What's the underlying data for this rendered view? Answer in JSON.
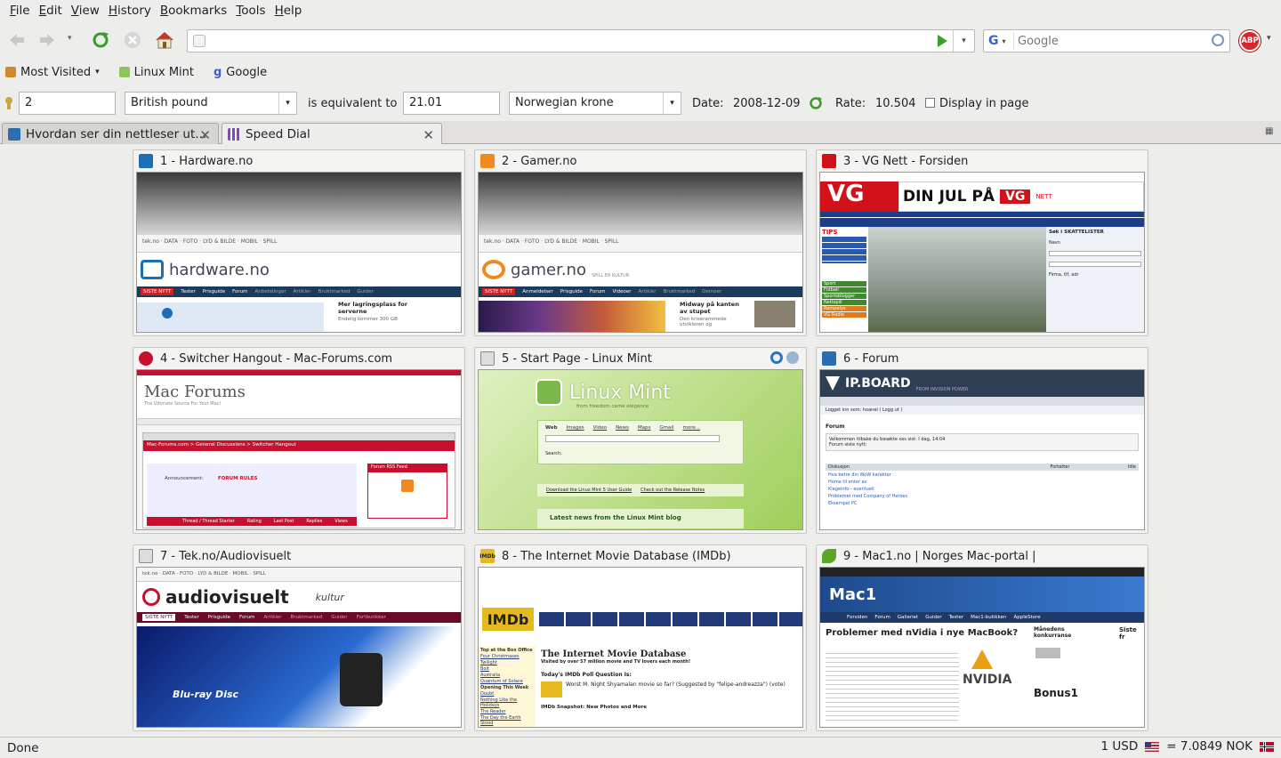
{
  "menubar": {
    "items": [
      {
        "label": "File",
        "key": "F",
        "rest": "ile"
      },
      {
        "label": "Edit",
        "key": "E",
        "rest": "dit"
      },
      {
        "label": "View",
        "key": "V",
        "rest": "iew"
      },
      {
        "label": "History",
        "key": "H",
        "rest": "istory"
      },
      {
        "label": "Bookmarks",
        "key": "B",
        "rest": "ookmarks"
      },
      {
        "label": "Tools",
        "key": "T",
        "rest": "ools"
      },
      {
        "label": "Help",
        "key": "H",
        "rest": "elp"
      }
    ]
  },
  "navbar": {
    "url_value": "",
    "search_placeholder": "Google",
    "search_engine": "G",
    "adblock_label": "ABP"
  },
  "bookmarks": {
    "items": [
      "Most Visited",
      "Linux Mint",
      "Google"
    ]
  },
  "currency": {
    "amount": "2",
    "from_currency": "British pound",
    "equivalent_label": "is equivalent to",
    "result": "21.01",
    "to_currency": "Norwegian krone",
    "date_label": "Date:",
    "date_value": "2008-12-09",
    "rate_label": "Rate:",
    "rate_value": "10.504",
    "display_label": "Display in page"
  },
  "tabs": [
    {
      "label": "Hvordan ser din nettleser ut...",
      "active": false
    },
    {
      "label": "Speed Dial",
      "active": true
    }
  ],
  "speed_dial": [
    {
      "title": "1 - Hardware.no",
      "color": "#1b6fb8"
    },
    {
      "title": "2 - Gamer.no",
      "color": "#f08a1c"
    },
    {
      "title": "3 - VG Nett - Forsiden",
      "color": "#d2121a"
    },
    {
      "title": "4 - Switcher Hangout - Mac-Forums.com",
      "color": "#c8102e"
    },
    {
      "title": "5 - Start Page - Linux Mint",
      "color": "#7a7a7a"
    },
    {
      "title": "6 - Forum",
      "color": "#2a6db0"
    },
    {
      "title": "7 - Tek.no/Audiovisuelt",
      "color": "#7a7a7a"
    },
    {
      "title": "8 - The Internet Movie Database (IMDb)",
      "color": "#e6b91e"
    },
    {
      "title": "9 - Mac1.no | Norges Mac-portal |",
      "color": "#5aa628"
    }
  ],
  "thumbs": {
    "t1": {
      "site": "hardware.no",
      "nav": [
        "SISTE NYTT",
        "Tester",
        "Prisguide",
        "Forum",
        "Anbefalinger",
        "Artikler",
        "Bruktmarked",
        "Guider"
      ],
      "headline": "Mer lagringsplass for serverne",
      "sub": "Endelig kommer 300 GB"
    },
    "t2": {
      "site": "gamer.no",
      "tag": "SPILL ER KULTUR",
      "nav": [
        "SISTE NYTT",
        "Anmeldelser",
        "Prisguide",
        "Forum",
        "Videoer",
        "Artikler",
        "Bruktmarked",
        "Demoer"
      ],
      "headline": "Midway på kanten av stupet",
      "sub": "Den kriserammede utvikleren og"
    },
    "t3": {
      "logo": "VG",
      "banner": "DIN JUL PÅ",
      "sub": "NETT",
      "tips": "TIPS",
      "menu": [
        "Sport",
        "Fotball",
        "Sportsblogger",
        "Nettspill",
        "Rampelys",
        "VG Radio"
      ],
      "side": "Søk i SKATTELISTER",
      "name": "Navn",
      "firma": "Firma, tlf, adr"
    },
    "t4": {
      "logo": "Mac Forums",
      "tagline": "The Ultimate Source For Your Mac!",
      "crumb": "Mac-Forums.com > General Discussions > Switcher Hangout",
      "announce": "Announcement:",
      "rules": "FORUM RULES",
      "feed": "Forum RSS Feed",
      "cols": [
        "Thread / Thread Starter",
        "Rating",
        "Last Post",
        "Replies",
        "Views"
      ]
    },
    "t5": {
      "logo": "Linux Mint",
      "tagline": "from freedom came elegance",
      "tabs": [
        "Web",
        "Images",
        "Video",
        "News",
        "Maps",
        "Gmail",
        "more..."
      ],
      "search": "Search:",
      "link1": "Download the Linux Mint 5 User Guide",
      "link2": "Check out the Release Notes",
      "news": "Latest news from the Linux Mint blog"
    },
    "t6": {
      "logo": "IP.BOARD",
      "tagline": "FROM INVISION POWER",
      "login": "Logget inn som: hoanel ( Logg ut )",
      "forum": "Forum",
      "welcome": "Velkommen tilbake du besøkte oss sist: I dag, 14:04",
      "lastpost": "Forum siste nytt:",
      "header": [
        "Diskusjon",
        "Fortatter",
        "Idle"
      ],
      "rows": [
        "Hva betre din WoW karakter",
        "Home til enter av",
        "Klageinfo - eventuell",
        "Problemet med Company of Heroes",
        "Eksempel PC"
      ]
    },
    "t7": {
      "site": "audiovisuelt",
      "tekno": "tek.no",
      "kultur": "kultur",
      "nav": [
        "SISTE NYTT",
        "Tester",
        "Prisguide",
        "Forum",
        "Artikler",
        "Bruktmarked",
        "Guider",
        "Fortbutikker"
      ],
      "bd": "Blu-ray Disc"
    },
    "t8": {
      "logo": "IMDb",
      "title": "The Internet Movie Database",
      "sub": "Visited by over 57 million movie and TV lovers each month!",
      "poll": "Today's IMDb Poll Question Is:",
      "question": "Worst M. Night Shyamalan movie so far? (Suggested by \"felipe-andreazza\") (vote)",
      "snapshot": "IMDb Snapshot: New Photos and More",
      "side": [
        "Top at the Box Office",
        "Four Christmases",
        "Twilight",
        "Bolt",
        "Australia",
        "Quantum of Solace",
        "Opening This Week",
        "Doubt",
        "Nothing Like the Holidays",
        "The Reader",
        "The Day the Earth Stood"
      ]
    },
    "t9": {
      "logo": "Mac1",
      "menu": [
        "Forsiden",
        "Forum",
        "Galleriet",
        "Guider",
        "Tester",
        "Mac1-butikken",
        "AppleStore"
      ],
      "headline": "Problemer med nVidia i nye MacBook?",
      "side1": "Månedens konkurranse",
      "side2": "Siste fr",
      "brand": "NVIDIA",
      "bonus": "Bonus1"
    }
  },
  "status": {
    "text": "Done",
    "usd": "1 USD",
    "nok": "= 7.0849 NOK"
  }
}
